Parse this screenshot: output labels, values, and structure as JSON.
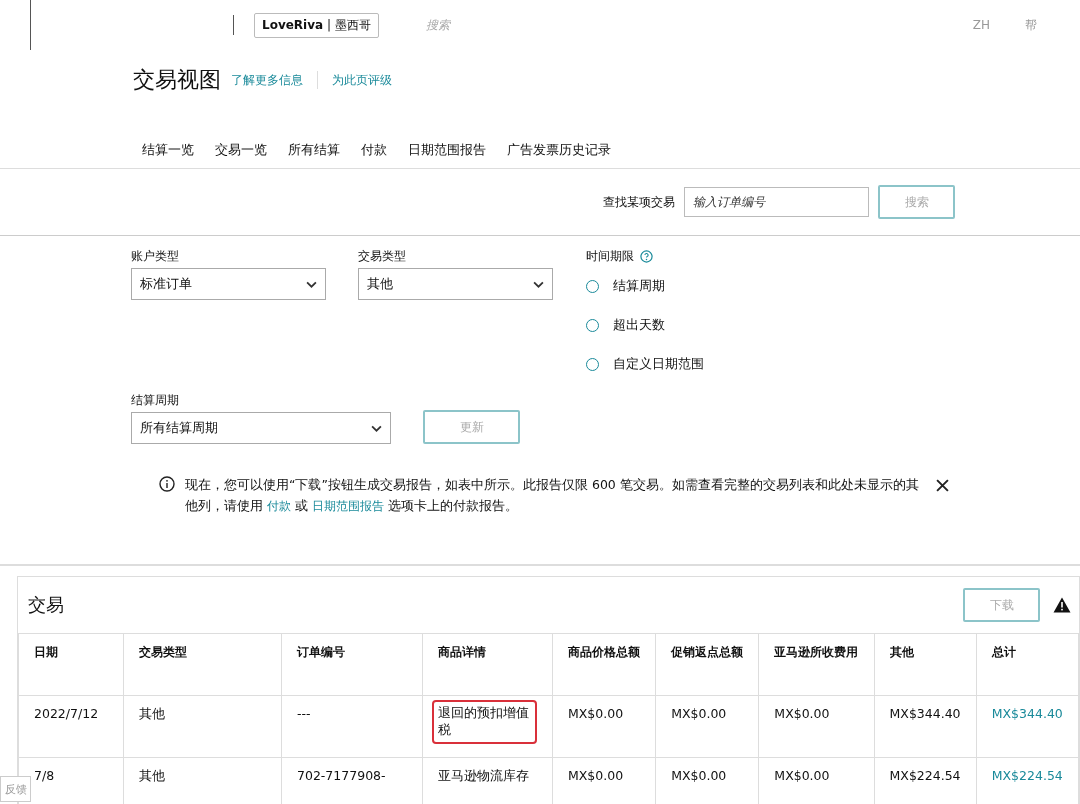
{
  "top_bar": {
    "store": "**LoveRiva** | 墨西哥",
    "search_placeholder": "搜索",
    "language": "ZH",
    "help": "帮"
  },
  "header": {
    "title": "交易视图",
    "links": [
      "了解更多信息",
      "为此页评级"
    ]
  },
  "tabs": [
    {
      "label": "结算一览",
      "selected": false
    },
    {
      "label": "交易一览",
      "selected": false
    },
    {
      "label": "所有结算",
      "selected": false
    },
    {
      "label": "付款",
      "selected": false
    },
    {
      "label": "日期范围报告",
      "selected": false
    },
    {
      "label": "广告发票历史记录",
      "selected": false
    }
  ],
  "find": {
    "label": "查找某项交易",
    "placeholder": "输入订单编号",
    "button": "搜索"
  },
  "filters": {
    "account_type": {
      "label": "账户类型",
      "value": "标准订单"
    },
    "transaction_type": {
      "label": "交易类型",
      "value": "其他"
    },
    "time_limit": {
      "label": "时间期限",
      "options": [
        {
          "label": "结算周期",
          "selected": false
        },
        {
          "label": "超出天数",
          "selected": false
        },
        {
          "label": "自定义日期范围",
          "selected": false
        }
      ]
    },
    "settlement_period": {
      "label": "结算周期",
      "value": "所有结算周期"
    },
    "update_button": "更新"
  },
  "notice": {
    "text_before": "现在，您可以使用“下载”按钮生成交易报告，如表中所示。此报告仅限 600 笔交易。如需查看完整的交易列表和此处未显示的其他列，请使用",
    "link_1": "付款",
    "middle": "或",
    "link_2": "日期范围报告",
    "text_after": "选项卡上的付款报告。"
  },
  "table": {
    "title": "交易",
    "download_button": "下载",
    "columns": [
      "日期",
      "交易类型",
      "订单编号",
      "商品详情",
      "商品价格总额",
      "促销返点总额",
      "亚马逊所收费用",
      "其他",
      "总计"
    ],
    "rows": [
      {
        "cells": [
          {
            "text": "2022/7/12",
            "highlighted": false
          },
          {
            "text": "其他",
            "highlighted": false
          },
          {
            "text": "---",
            "highlighted": false
          },
          {
            "text": "退回的预扣增值税",
            "highlighted": true
          },
          {
            "text": "MX$0.00",
            "highlighted": false
          },
          {
            "text": "MX$0.00",
            "highlighted": false
          },
          {
            "text": "MX$0.00",
            "highlighted": false
          },
          {
            "text": "MX$344.40",
            "highlighted": false
          },
          {
            "text": "MX$344.40",
            "highlighted": false
          }
        ]
      },
      {
        "cells": [
          {
            "text": "7/8",
            "highlighted": false
          },
          {
            "text": "其他",
            "highlighted": false
          },
          {
            "text": "702-7177908-",
            "highlighted": false
          },
          {
            "text": "亚马逊物流库存",
            "highlighted": false
          },
          {
            "text": "MX$0.00",
            "highlighted": false
          },
          {
            "text": "MX$0.00",
            "highlighted": false
          },
          {
            "text": "MX$0.00",
            "highlighted": false
          },
          {
            "text": "MX$224.54",
            "highlighted": false
          },
          {
            "text": "MX$224.54",
            "highlighted": false
          }
        ]
      }
    ]
  },
  "feedback_tab": "反馈"
}
